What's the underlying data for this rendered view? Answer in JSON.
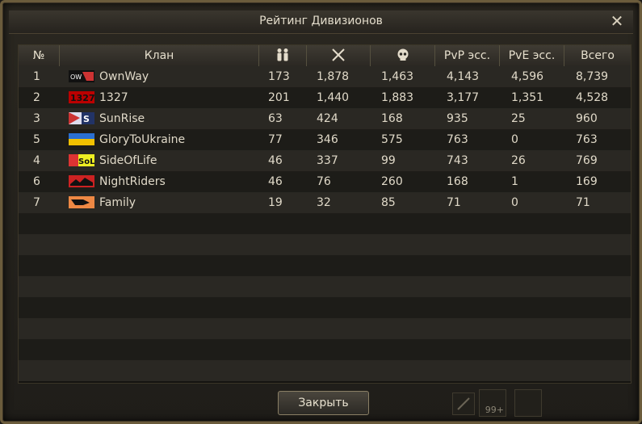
{
  "window": {
    "title": "Рейтинг Дивизионов"
  },
  "table": {
    "headers": {
      "num": "№",
      "clan": "Клан",
      "members_icon": "people-icon",
      "kills_icon": "crossed-swords-icon",
      "deaths_icon": "skull-icon",
      "pvp": "PvP эсс.",
      "pve": "PvE эсс.",
      "total": "Всего"
    },
    "rows": [
      {
        "num": "1",
        "clan": "OwnWay",
        "members": "173",
        "kills": "1,878",
        "deaths": "1,463",
        "pvp": "4,143",
        "pve": "4,596",
        "total": "8,739",
        "emblem": "ownway-emblem"
      },
      {
        "num": "2",
        "clan": "1327",
        "members": "201",
        "kills": "1,440",
        "deaths": "1,883",
        "pvp": "3,177",
        "pve": "1,351",
        "total": "4,528",
        "emblem": "1327-emblem"
      },
      {
        "num": "3",
        "clan": "SunRise",
        "members": "63",
        "kills": "424",
        "deaths": "168",
        "pvp": "935",
        "pve": "25",
        "total": "960",
        "emblem": "sunrise-emblem"
      },
      {
        "num": "5",
        "clan": "GloryToUkraine",
        "members": "77",
        "kills": "346",
        "deaths": "575",
        "pvp": "763",
        "pve": "0",
        "total": "763",
        "emblem": "ukraine-flag-emblem"
      },
      {
        "num": "4",
        "clan": "SideOfLife",
        "members": "46",
        "kills": "337",
        "deaths": "99",
        "pvp": "743",
        "pve": "26",
        "total": "769",
        "emblem": "sideoflife-emblem"
      },
      {
        "num": "6",
        "clan": "NightRiders",
        "members": "46",
        "kills": "76",
        "deaths": "260",
        "pvp": "168",
        "pve": "1",
        "total": "169",
        "emblem": "nightriders-emblem"
      },
      {
        "num": "7",
        "clan": "Family",
        "members": "19",
        "kills": "32",
        "deaths": "85",
        "pvp": "71",
        "pve": "0",
        "total": "71",
        "emblem": "family-emblem"
      }
    ]
  },
  "footer": {
    "close_button": "Закрыть",
    "slot_badge": "99+"
  },
  "colors": {
    "accent": "#8a7a52",
    "text": "#e0d9c8",
    "row_odd": "#2a2823",
    "row_even": "#1d1c18"
  }
}
